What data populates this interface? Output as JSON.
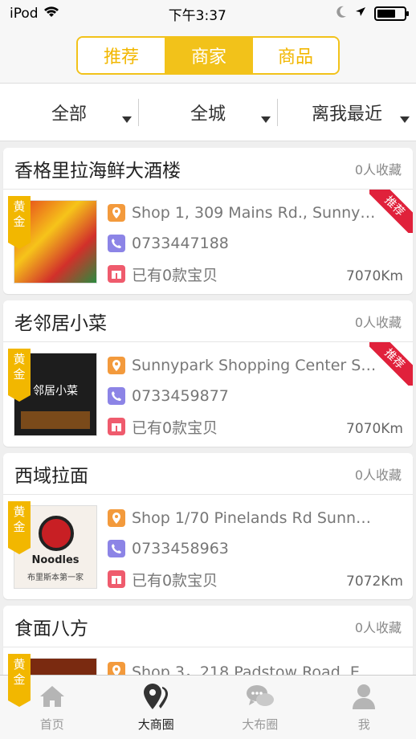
{
  "status_bar": {
    "carrier": "iPod",
    "time": "下午3:37"
  },
  "segments": [
    {
      "label": "推荐",
      "active": false
    },
    {
      "label": "商家",
      "active": true
    },
    {
      "label": "商品",
      "active": false
    }
  ],
  "filters": [
    "全部",
    "全城",
    "离我最近"
  ],
  "common": {
    "gold_tag": "黄金",
    "ribbon": "推荐"
  },
  "shops": [
    {
      "name": "香格里拉海鲜大酒楼",
      "favorites": "0人收藏",
      "address": "Shop 1, 309 Mains Rd., Sunny…",
      "phone": "0733447188",
      "items": "已有0款宝贝",
      "distance": "7070Km",
      "recommended": true
    },
    {
      "name": "老邻居小菜",
      "favorites": "0人收藏",
      "address": "Sunnypark Shopping Center S…",
      "phone": "0733459877",
      "items": "已有0款宝贝",
      "distance": "7070Km",
      "recommended": true
    },
    {
      "name": "西域拉面",
      "favorites": "0人收藏",
      "address": "Shop 1/70 Pinelands Rd Sunn…",
      "phone": "0733458963",
      "items": "已有0款宝贝",
      "distance": "7072Km",
      "recommended": false
    },
    {
      "name": "食面八方",
      "favorites": "0人收藏",
      "address": "Shop 3，218 Padstow Road, E…"
    }
  ],
  "thumb_text": {
    "shop2_sign": "邻居小菜",
    "shop3_title": "Noodles",
    "shop3_sub": "布里斯本第一家"
  },
  "tabs": [
    {
      "label": "首页",
      "icon": "home-icon",
      "active": false
    },
    {
      "label": "大商圈",
      "icon": "map-pin-icon",
      "active": true
    },
    {
      "label": "大布圈",
      "icon": "chat-bubbles-icon",
      "active": false
    },
    {
      "label": "我",
      "icon": "person-icon",
      "active": false
    }
  ]
}
